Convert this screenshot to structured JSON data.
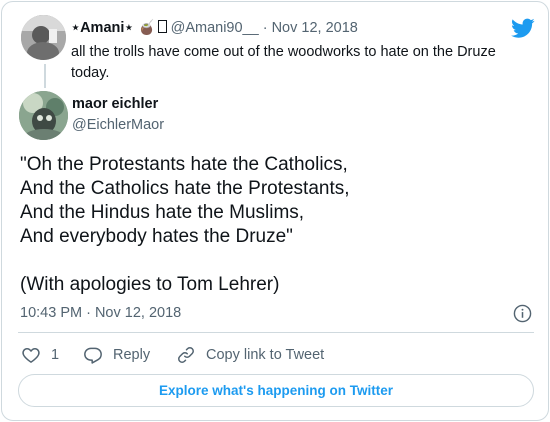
{
  "parent_tweet": {
    "author_name": "⋆Amani⋆",
    "author_emoji": "🧉",
    "author_handle": "@Amani90__",
    "separator": "·",
    "date": "Nov 12, 2018",
    "text": "all the trolls have come out of the woodworks to hate on the Druze today."
  },
  "main_tweet": {
    "author_name": "maor eichler",
    "author_handle": "@EichlerMaor",
    "lines": [
      "\"Oh the Protestants hate the Catholics,",
      "And the Catholics hate the Protestants,",
      "And the Hindus hate the Muslims,",
      "And everybody hates the Druze\"",
      "",
      "(With apologies to Tom Lehrer)"
    ],
    "timestamp": "10:43 PM · Nov 12, 2018"
  },
  "actions": {
    "like_count": "1",
    "reply_label": "Reply",
    "copy_link_label": "Copy link to Tweet"
  },
  "explore_label": "Explore what's happening on Twitter",
  "icons": {
    "brand": "twitter-bird-icon",
    "info": "info-icon",
    "like": "heart-icon",
    "reply": "reply-icon",
    "copy": "link-icon"
  },
  "colors": {
    "brand_blue": "#1d9bf0",
    "muted_text": "#536471",
    "border": "#cfd9de"
  }
}
